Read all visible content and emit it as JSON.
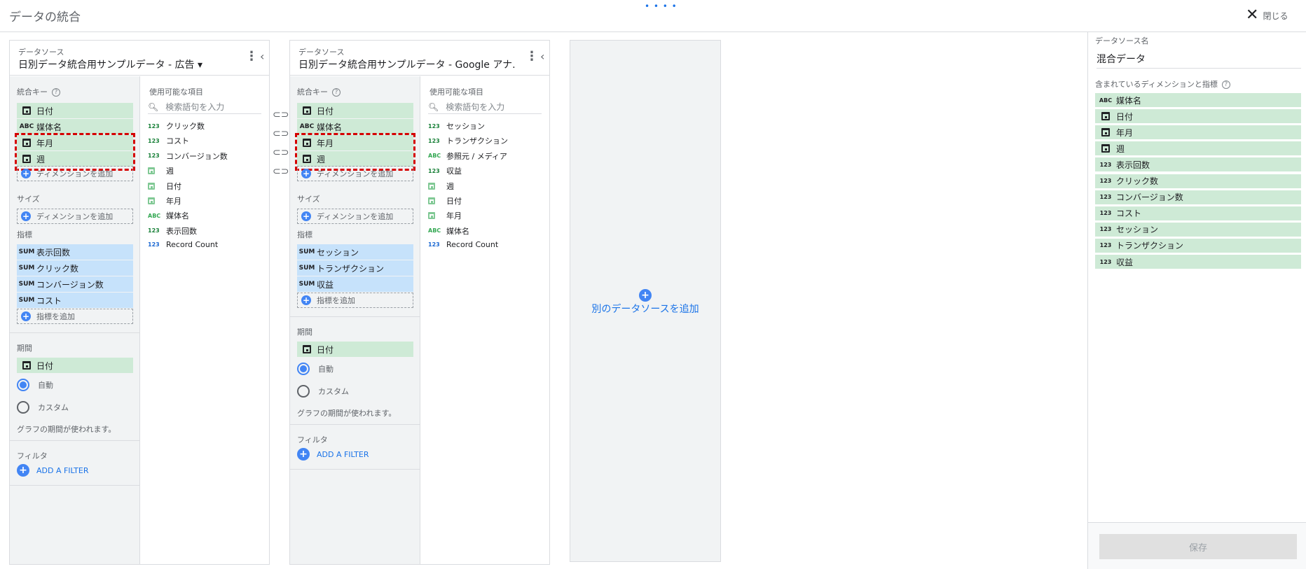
{
  "header": {
    "title": "データの統合",
    "drag_handle": "• • • •",
    "close_label": "閉じる"
  },
  "panels": [
    {
      "source_caption": "データソース",
      "source_name": "日別データ統合用サンプルデータ - 広告 ▾",
      "join_keys_label": "統合キー",
      "join_keys": [
        {
          "type": "date",
          "label": "日付"
        },
        {
          "type": "text",
          "label": "媒体名"
        },
        {
          "type": "date",
          "label": "年月"
        },
        {
          "type": "date",
          "label": "週"
        }
      ],
      "add_dimension": "ディメンションを追加",
      "size_label": "サイズ",
      "metrics_label": "指標",
      "metrics": [
        "表示回数",
        "クリック数",
        "コンバージョン数",
        "コスト"
      ],
      "add_metric": "指標を追加",
      "period_label": "期間",
      "period_field": "日付",
      "radio_auto": "自動",
      "radio_custom": "カスタム",
      "period_hint": "グラフの期間が使われます。",
      "filter_label": "フィルタ",
      "add_filter": "ADD A FILTER",
      "available_label": "使用可能な項目",
      "search_placeholder": "検索語句を入力",
      "available": [
        {
          "type": "num",
          "label": "クリック数"
        },
        {
          "type": "num",
          "label": "コスト"
        },
        {
          "type": "num",
          "label": "コンバージョン数"
        },
        {
          "type": "date",
          "label": "週"
        },
        {
          "type": "date",
          "label": "日付"
        },
        {
          "type": "date",
          "label": "年月"
        },
        {
          "type": "text",
          "label": "媒体名"
        },
        {
          "type": "num",
          "label": "表示回数"
        },
        {
          "type": "numb",
          "label": "Record Count"
        }
      ]
    },
    {
      "source_caption": "データソース",
      "source_name": "日別データ統合用サンプルデータ - Google アナ...",
      "join_keys_label": "統合キー",
      "join_keys": [
        {
          "type": "date",
          "label": "日付"
        },
        {
          "type": "text",
          "label": "媒体名"
        },
        {
          "type": "date",
          "label": "年月"
        },
        {
          "type": "date",
          "label": "週"
        }
      ],
      "add_dimension": "ディメンションを追加",
      "size_label": "サイズ",
      "metrics_label": "指標",
      "metrics": [
        "セッション",
        "トランザクション",
        "収益"
      ],
      "add_metric": "指標を追加",
      "period_label": "期間",
      "period_field": "日付",
      "radio_auto": "自動",
      "radio_custom": "カスタム",
      "period_hint": "グラフの期間が使われます。",
      "filter_label": "フィルタ",
      "add_filter": "ADD A FILTER",
      "available_label": "使用可能な項目",
      "search_placeholder": "検索語句を入力",
      "available": [
        {
          "type": "num",
          "label": "セッション"
        },
        {
          "type": "num",
          "label": "トランザクション"
        },
        {
          "type": "text",
          "label": "参照元 / メディア"
        },
        {
          "type": "num",
          "label": "収益"
        },
        {
          "type": "date",
          "label": "週"
        },
        {
          "type": "date",
          "label": "日付"
        },
        {
          "type": "date",
          "label": "年月"
        },
        {
          "type": "text",
          "label": "媒体名"
        },
        {
          "type": "numb",
          "label": "Record Count"
        }
      ]
    }
  ],
  "add_source": {
    "label": "別のデータソースを追加"
  },
  "sidebar": {
    "name_caption": "データソース名",
    "name_value": "混合データ",
    "contents_caption": "含まれているディメンションと指標",
    "items": [
      {
        "type": "text",
        "label": "媒体名"
      },
      {
        "type": "date",
        "label": "日付"
      },
      {
        "type": "date",
        "label": "年月"
      },
      {
        "type": "date",
        "label": "週"
      },
      {
        "type": "num",
        "label": "表示回数"
      },
      {
        "type": "num",
        "label": "クリック数"
      },
      {
        "type": "num",
        "label": "コンバージョン数"
      },
      {
        "type": "num",
        "label": "コスト"
      },
      {
        "type": "num",
        "label": "セッション"
      },
      {
        "type": "num",
        "label": "トランザクション"
      },
      {
        "type": "num",
        "label": "収益"
      }
    ],
    "save_label": "保存"
  },
  "type_badges": {
    "text": "ABC",
    "num": "123",
    "sum": "SUM"
  },
  "colors": {
    "dimension": "#ceead6",
    "metric": "#c6e2fb",
    "accent": "#4285f4",
    "highlight": "#d50000"
  }
}
